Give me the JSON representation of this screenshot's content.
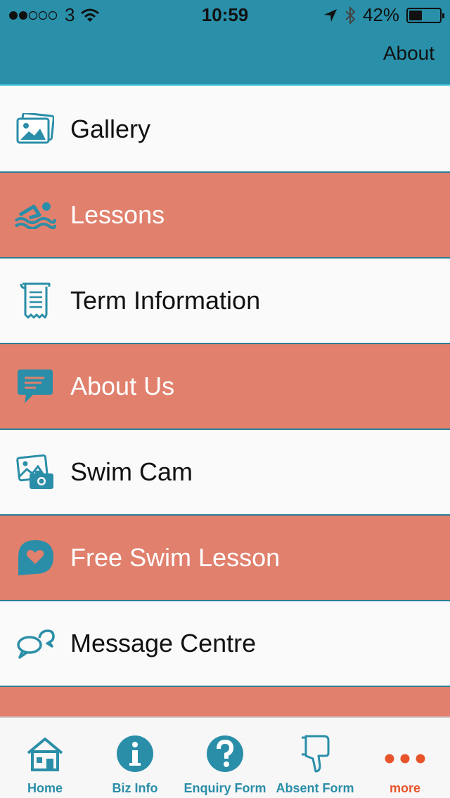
{
  "status": {
    "carrier": "3",
    "time": "10:59",
    "battery": "42%",
    "battery_level": 0.42
  },
  "navbar": {
    "about_label": "About"
  },
  "menu": {
    "items": [
      {
        "label": "Gallery",
        "icon": "gallery-icon"
      },
      {
        "label": "Lessons",
        "icon": "swimmer-icon"
      },
      {
        "label": "Term Information",
        "icon": "scroll-icon"
      },
      {
        "label": "About Us",
        "icon": "chat-bubble-icon"
      },
      {
        "label": "Swim Cam",
        "icon": "camera-photo-icon"
      },
      {
        "label": "Free Swim Lesson",
        "icon": "heart-bubble-icon"
      },
      {
        "label": "Message Centre",
        "icon": "message-bubbles-icon"
      }
    ]
  },
  "tabbar": {
    "tabs": [
      {
        "label": "Home",
        "icon": "home-icon"
      },
      {
        "label": "Biz Info",
        "icon": "info-icon"
      },
      {
        "label": "Enquiry Form",
        "icon": "question-icon"
      },
      {
        "label": "Absent Form",
        "icon": "thumbs-down-icon"
      },
      {
        "label": "more",
        "icon": "more-dots-icon"
      }
    ]
  },
  "colors": {
    "accent": "#2a90aa",
    "coral": "#e0806d",
    "more": "#e8542a"
  }
}
